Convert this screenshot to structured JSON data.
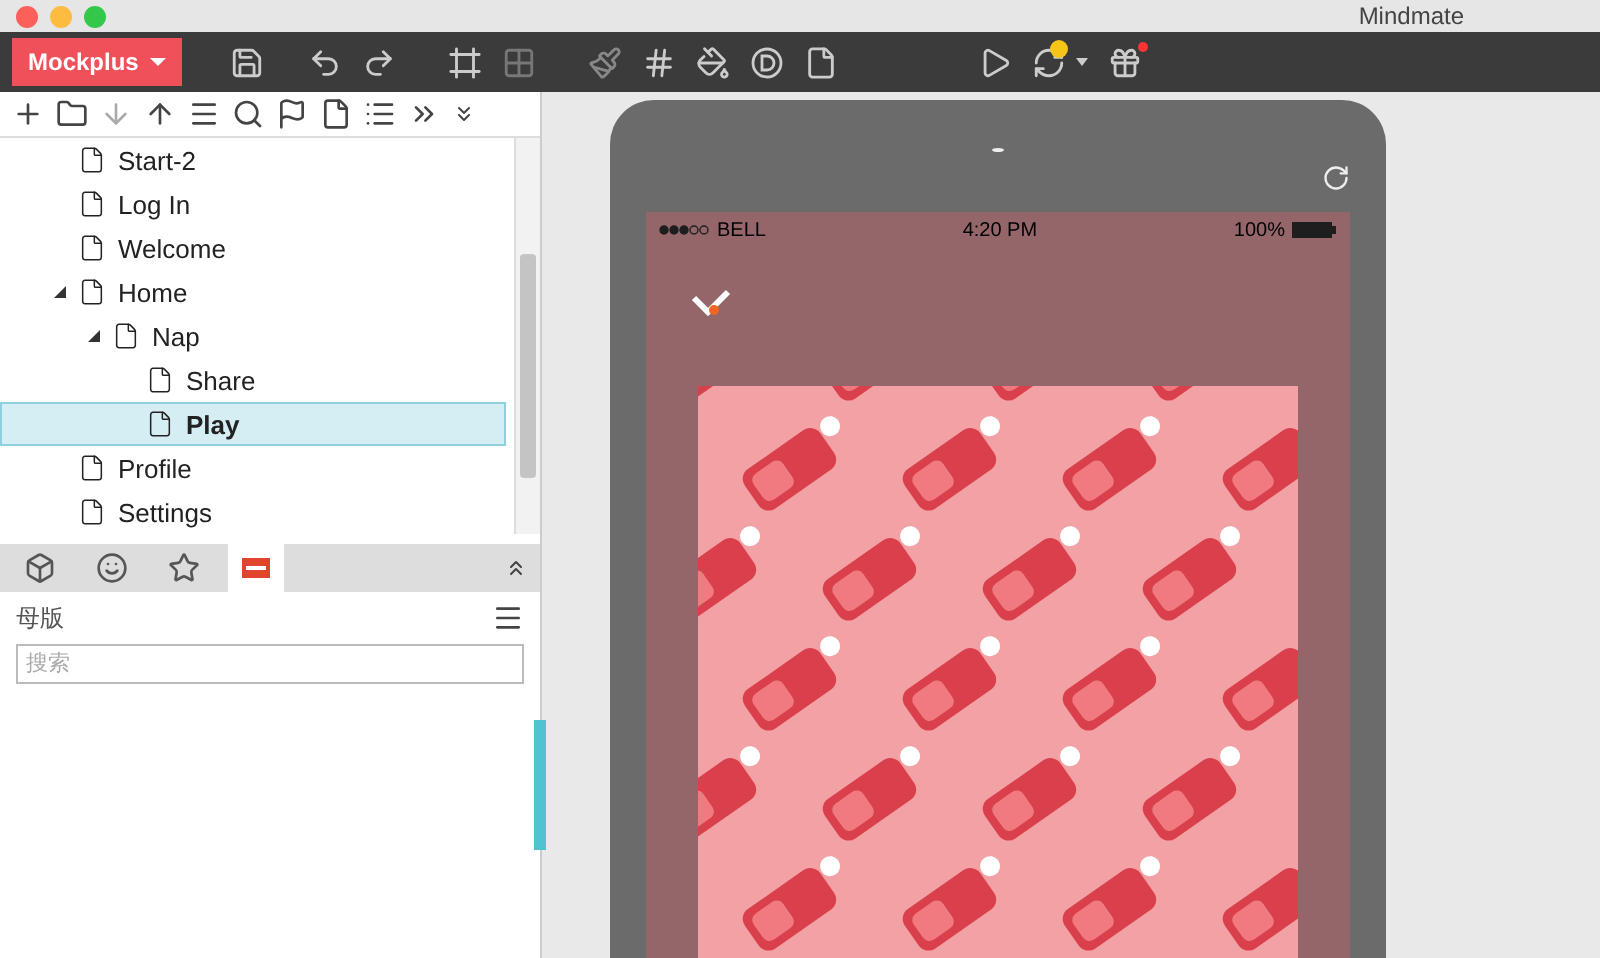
{
  "window": {
    "title": "Mindmate"
  },
  "toolbar": {
    "app_menu": "Mockplus"
  },
  "tree": [
    {
      "label": "Start-2",
      "selected": false
    },
    {
      "label": "Log In",
      "selected": false
    },
    {
      "label": "Welcome",
      "selected": false
    },
    {
      "label": "Home",
      "selected": false,
      "expanded": true,
      "children": [
        {
          "label": "Nap",
          "selected": false,
          "expanded": true,
          "children": [
            {
              "label": "Share",
              "selected": false
            },
            {
              "label": "Play",
              "selected": true
            }
          ]
        }
      ]
    },
    {
      "label": "Profile",
      "selected": false
    },
    {
      "label": "Settings",
      "selected": false
    }
  ],
  "panel_tabs": [
    {
      "kind": "cube",
      "selected": false
    },
    {
      "kind": "smiley",
      "selected": false
    },
    {
      "kind": "star",
      "selected": false
    },
    {
      "kind": "master",
      "selected": true
    }
  ],
  "masters": {
    "title": "母版",
    "search": {
      "placeholder": "搜索"
    }
  },
  "phone": {
    "status_bar": {
      "carrier": "BELL",
      "time": "4:20 PM",
      "battery": "100%"
    }
  }
}
